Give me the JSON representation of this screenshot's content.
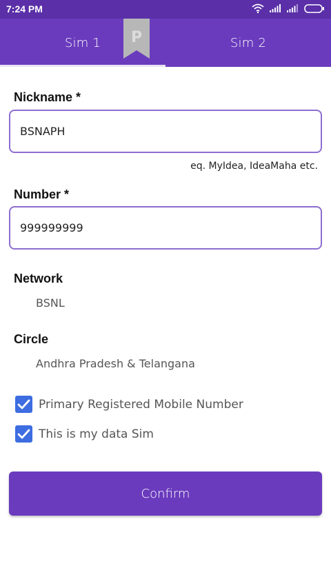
{
  "status_bar": {
    "time": "7:24 PM",
    "icons": [
      "wifi-icon",
      "signal-icon",
      "signal-icon",
      "battery-icon"
    ]
  },
  "tabs": [
    {
      "label": "Sim 1",
      "active": true
    },
    {
      "label": "Sim 2",
      "active": false
    }
  ],
  "bookmark": {
    "letter": "P"
  },
  "form": {
    "nickname": {
      "label": "Nickname *",
      "value": "BSNAPH",
      "hint": "eq. MyIdea, IdeaMaha etc."
    },
    "number": {
      "label": "Number *",
      "value": "999999999"
    },
    "network": {
      "label": "Network",
      "value": "BSNL"
    },
    "circle": {
      "label": "Circle",
      "value": "Andhra Pradesh & Telangana"
    },
    "checkboxes": [
      {
        "label": "Primary Registered Mobile Number",
        "checked": true
      },
      {
        "label": "This is my data Sim",
        "checked": true
      }
    ]
  },
  "confirm_label": "Confirm",
  "colors": {
    "status_bar": "#5a2fa8",
    "primary": "#6a3bbd",
    "field_border": "#8d6dd0",
    "checkbox": "#3d6de0"
  }
}
